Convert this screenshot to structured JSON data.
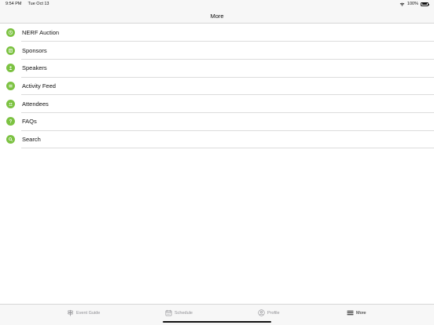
{
  "status_bar": {
    "time": "9:54 PM",
    "date": "Tue Oct 13",
    "battery": "100%"
  },
  "nav": {
    "title": "More"
  },
  "menu": {
    "items": [
      {
        "label": "NERF Auction",
        "icon": "auction-icon"
      },
      {
        "label": "Sponsors",
        "icon": "sponsors-icon"
      },
      {
        "label": "Speakers",
        "icon": "speakers-icon"
      },
      {
        "label": "Activity Feed",
        "icon": "activity-feed-icon"
      },
      {
        "label": "Attendees",
        "icon": "attendees-icon"
      },
      {
        "label": "FAQs",
        "icon": "question-icon"
      },
      {
        "label": "Search",
        "icon": "search-icon"
      }
    ]
  },
  "tabs": [
    {
      "label": "Event Guide",
      "icon": "signpost-icon"
    },
    {
      "label": "Schedule",
      "icon": "calendar-icon"
    },
    {
      "label": "Profile",
      "icon": "person-icon"
    },
    {
      "label": "More",
      "icon": "menu-icon"
    }
  ],
  "colors": {
    "accent_green": "#7cc242",
    "tab_inactive": "#8e8e93",
    "bar_background": "#f7f7f7"
  }
}
